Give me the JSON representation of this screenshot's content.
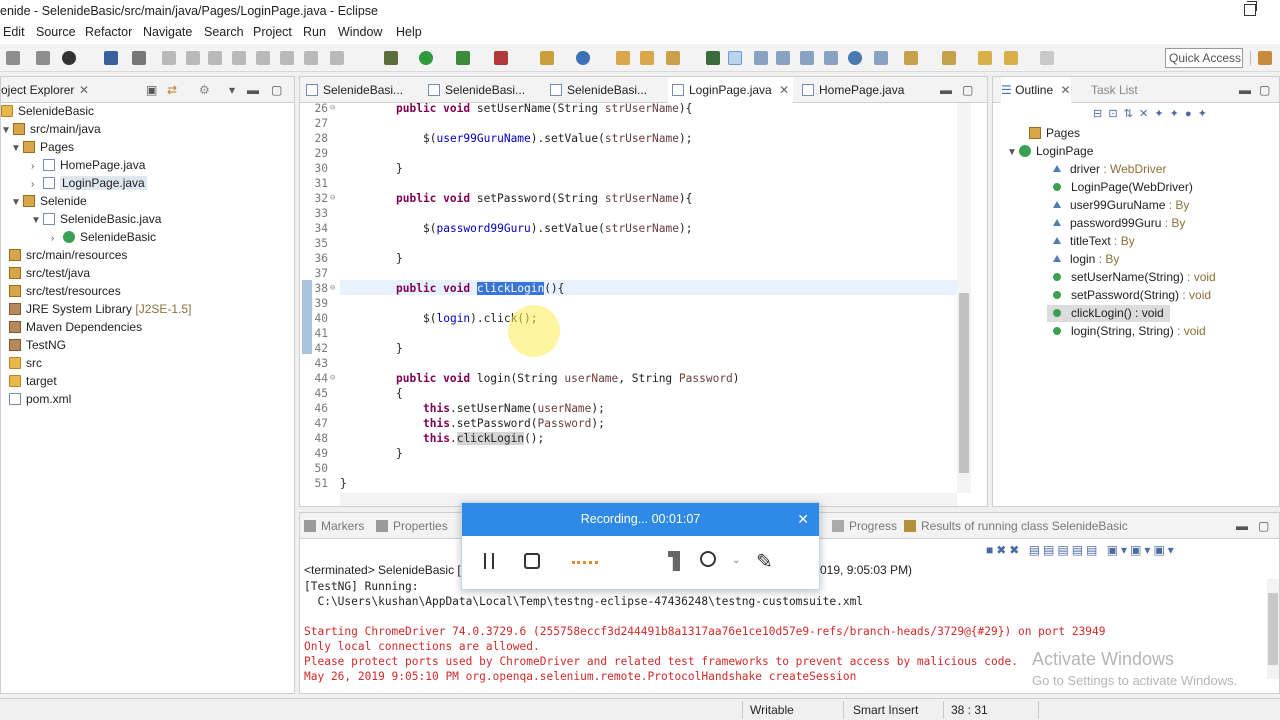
{
  "window": {
    "title": "enide - SelenideBasic/src/main/java/Pages/LoginPage.java - Eclipse"
  },
  "menu": [
    "Edit",
    "Source",
    "Refactor",
    "Navigate",
    "Search",
    "Project",
    "Run",
    "Window",
    "Help"
  ],
  "toolbar": {
    "quick_access": "Quick Access"
  },
  "project_explorer": {
    "title": "oject Explorer",
    "items": [
      {
        "label": "SelenideBasic",
        "icon": "project-icon"
      },
      {
        "label": "src/main/java",
        "icon": "source-folder-icon"
      },
      {
        "label": "Pages",
        "icon": "package-icon"
      },
      {
        "label": "HomePage.java",
        "icon": "java-file-icon"
      },
      {
        "label": "LoginPage.java",
        "icon": "java-file-icon"
      },
      {
        "label": "Selenide",
        "icon": "package-icon"
      },
      {
        "label": "SelenideBasic.java",
        "icon": "java-file-icon"
      },
      {
        "label": "SelenideBasic",
        "icon": "class-icon"
      },
      {
        "label": "src/main/resources",
        "icon": "source-folder-icon"
      },
      {
        "label": "src/test/java",
        "icon": "source-folder-icon"
      },
      {
        "label": "src/test/resources",
        "icon": "source-folder-icon"
      },
      {
        "label": "JRE System Library",
        "suffix": "[J2SE-1.5]",
        "icon": "library-icon"
      },
      {
        "label": "Maven Dependencies",
        "icon": "library-icon"
      },
      {
        "label": "TestNG",
        "icon": "library-icon"
      },
      {
        "label": "src",
        "icon": "folder-icon"
      },
      {
        "label": "target",
        "icon": "folder-icon"
      },
      {
        "label": "pom.xml",
        "icon": "xml-file-icon"
      }
    ]
  },
  "editor": {
    "tabs": [
      "SelenideBasi...",
      "SelenideBasi...",
      "SelenideBasi...",
      "LoginPage.java",
      "HomePage.java"
    ],
    "active_tab": "LoginPage.java",
    "line_numbers": [
      "26",
      "27",
      "28",
      "29",
      "30",
      "31",
      "32",
      "33",
      "34",
      "35",
      "36",
      "37",
      "38",
      "39",
      "40",
      "41",
      "42",
      "43",
      "44",
      "45",
      "46",
      "47",
      "48",
      "49",
      "50",
      "51"
    ],
    "code": {
      "l26": {
        "kw": "public void ",
        "rest": "setUserName(String ",
        "par": "strUserName",
        "end": "){"
      },
      "l28": {
        "pre": "$(",
        "fld": "user99GuruName",
        "mid": ").setValue(",
        "par": "strUserName",
        "end": ");"
      },
      "l30": "}",
      "l32": {
        "kw": "public void ",
        "rest": "setPassword(String ",
        "par": "strUserName",
        "end": "){"
      },
      "l34": {
        "pre": "$(",
        "fld": "password99Guru",
        "mid": ").setValue(",
        "par": "strUserName",
        "end": ");"
      },
      "l36": "}",
      "l38": {
        "kw": "public void ",
        "sel": "clickLogin",
        "end": "(){"
      },
      "l40": {
        "pre": "$(",
        "fld": "login",
        "end": ").click();"
      },
      "l42": "}",
      "l44": {
        "kw": "public void ",
        "rest": "login(String ",
        "par": "userName",
        "mid": ", String ",
        "par2": "Password",
        "end": ")"
      },
      "l45": "{",
      "l46": {
        "kw": "this",
        "rest": ".setUserName(",
        "par": "userName",
        "end": ");"
      },
      "l47": {
        "kw": "this",
        "rest": ".setPassword(",
        "par": "Password",
        "end": ");"
      },
      "l48": {
        "kw": "this",
        "rest": ".",
        "occ": "clickLogin",
        "end": "();"
      },
      "l49": "}",
      "l51": "}"
    }
  },
  "outline": {
    "tabs": [
      "Outline",
      "Task List"
    ],
    "items": [
      {
        "label": "Pages",
        "type": ""
      },
      {
        "label": "LoginPage",
        "type": ""
      },
      {
        "label": "driver",
        "type": " : WebDriver"
      },
      {
        "label": "LoginPage(WebDriver)",
        "type": ""
      },
      {
        "label": "user99GuruName",
        "type": " : By"
      },
      {
        "label": "password99Guru",
        "type": " : By"
      },
      {
        "label": "titleText",
        "type": " : By"
      },
      {
        "label": "login",
        "type": " : By"
      },
      {
        "label": "setUserName(String)",
        "type": " : void"
      },
      {
        "label": "setPassword(String)",
        "type": " : void"
      },
      {
        "label": "clickLogin()",
        "type": " : void"
      },
      {
        "label": "login(String, String)",
        "type": " : void"
      }
    ]
  },
  "bottom": {
    "tabs": [
      "Markers",
      "Properties"
    ],
    "right_tabs": [
      "Progress",
      "Results of running class SelenideBasic"
    ],
    "terminated": "<terminated> SelenideBasic [T",
    "terminated_time": "019, 9:05:03 PM)",
    "console": [
      {
        "text": "[TestNG] Running:",
        "color": "#222"
      },
      {
        "text": "  C:\\Users\\kushan\\AppData\\Local\\Temp\\testng-eclipse-47436248\\testng-customsuite.xml",
        "color": "#222"
      },
      {
        "text": "",
        "color": "#222"
      },
      {
        "text": "Starting ChromeDriver 74.0.3729.6 (255758eccf3d244491b8a1317aa76e1ce10d57e9-refs/branch-heads/3729@{#29}) on port 23949",
        "color": "#d12a2a"
      },
      {
        "text": "Only local connections are allowed.",
        "color": "#d12a2a"
      },
      {
        "text": "Please protect ports used by ChromeDriver and related test frameworks to prevent access by malicious code.",
        "color": "#d12a2a"
      },
      {
        "text": "May 26, 2019 9:05:10 PM org.openqa.selenium.remote.ProtocolHandshake createSession",
        "color": "#d12a2a"
      }
    ]
  },
  "recorder": {
    "title": "Recording... 00:01:07"
  },
  "watermark": {
    "line1": "Activate Windows",
    "line2": "Go to Settings to activate Windows."
  },
  "status": {
    "writable": "Writable",
    "mode": "Smart Insert",
    "position": "38 : 31"
  }
}
